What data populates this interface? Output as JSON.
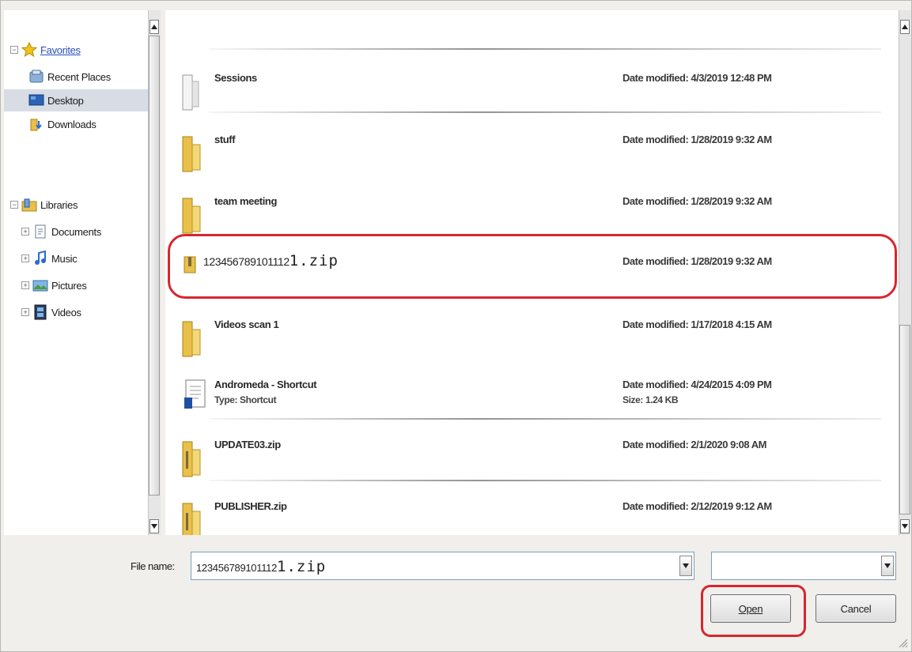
{
  "nav": {
    "favorites": "Favorites",
    "recent_places": "Recent Places",
    "desktop": "Desktop",
    "downloads": "Downloads",
    "libraries": "Libraries",
    "documents": "Documents",
    "music": "Music",
    "pictures": "Pictures",
    "videos": "Videos",
    "collapse_glyph": "−",
    "expand_glyph": "+"
  },
  "files": [
    {
      "name": "Sessions",
      "detail": "Date modified: 4/3/2019 12:48 PM",
      "type": "folder"
    },
    {
      "name": "stuff",
      "detail": "Date modified: 1/28/2019 9:32 AM",
      "type": "folder"
    },
    {
      "name": "team meeting",
      "detail": "Date modified: 1/28/2019 9:32 AM",
      "type": "folder"
    },
    {
      "name": "123456789101112",
      "ext": "1.zip",
      "detail": "Date modified: 1/28/2019 9:32 AM",
      "type": "zip"
    },
    {
      "name": "Videos scan 1",
      "detail": "Date modified: 1/17/2018 4:15 AM",
      "type": "folder"
    },
    {
      "name": "Andromeda - Shortcut",
      "sub": "Type: Shortcut",
      "detail": "Date modified: 4/24/2015 4:09 PM",
      "size": "Size: 1.24 KB",
      "type": "shortcut"
    },
    {
      "name": "UPDATE03.zip",
      "detail": "Date modified: 2/1/2020 9:08 AM",
      "type": "zipfolder"
    },
    {
      "name": "PUBLISHER.zip",
      "detail": "Date modified: 2/12/2019 9:12 AM",
      "type": "zipfolder"
    }
  ],
  "footer": {
    "file_name_label": "File name:",
    "file_name_value": "123456789101112",
    "file_name_ext": "1.zip",
    "file_type_value": "",
    "open_label": "Open",
    "cancel_label": "Cancel"
  },
  "colors": {
    "highlight": "#d7262e",
    "folder": "#e8c04a",
    "link": "#2850b8"
  }
}
